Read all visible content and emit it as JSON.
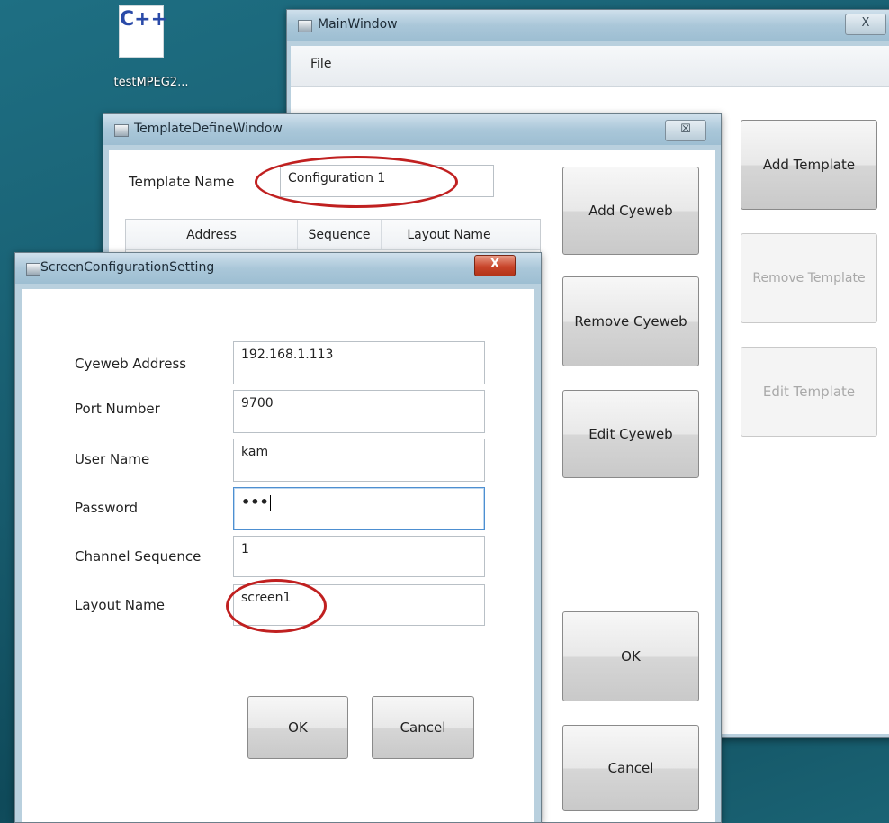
{
  "desktop": {
    "icon_glyph": "C++",
    "icon_label": "testMPEG2..."
  },
  "main_window": {
    "title": "MainWindow",
    "close_glyph": "X",
    "menu": {
      "file": "File"
    },
    "buttons": {
      "add_template": "Add Template",
      "remove_template": "Remove Template",
      "edit_template": "Edit Template"
    }
  },
  "template_window": {
    "title": "TemplateDefineWindow",
    "close_glyph": "☒",
    "template_name_label": "Template Name",
    "template_name_value": "Configuration 1",
    "table": {
      "headers": [
        "Address",
        "Sequence",
        "Layout Name"
      ]
    },
    "buttons": {
      "add_cyeweb": "Add Cyeweb",
      "remove_cyeweb": "Remove Cyeweb",
      "edit_cyeweb": "Edit Cyeweb",
      "ok": "OK",
      "cancel": "Cancel"
    }
  },
  "screen_dialog": {
    "title": "ScreenConfigurationSetting",
    "close_glyph": "X",
    "fields": [
      {
        "label": "Cyeweb Address",
        "value": "192.168.1.113"
      },
      {
        "label": "Port Number",
        "value": "9700"
      },
      {
        "label": "User Name",
        "value": "kam"
      },
      {
        "label": "Password",
        "value": "•••"
      },
      {
        "label": "Channel Sequence",
        "value": "1"
      },
      {
        "label": "Layout Name",
        "value": "screen1"
      }
    ],
    "buttons": {
      "ok": "OK",
      "cancel": "Cancel"
    }
  },
  "colors": {
    "highlight_ellipse": "#c02020",
    "desktop": "#1a6374"
  }
}
